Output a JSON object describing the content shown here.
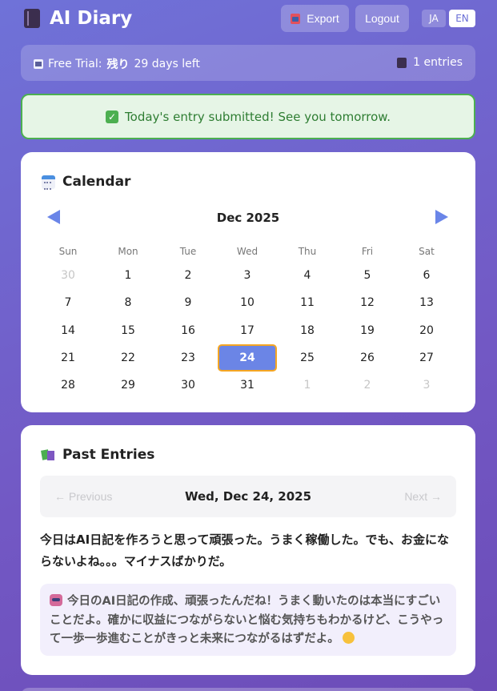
{
  "header": {
    "title": "AI Diary",
    "export_label": "Export",
    "logout_label": "Logout",
    "lang_ja": "JA",
    "lang_en": "EN",
    "selected_language": "EN"
  },
  "trial": {
    "label": "Free Trial:",
    "jp": "残り",
    "days": "29 days left",
    "entries": "1 entries"
  },
  "success_message": "Today's entry submitted! See you tomorrow.",
  "calendar": {
    "title": "Calendar",
    "month": "Dec 2025",
    "weekdays": [
      "Sun",
      "Mon",
      "Tue",
      "Wed",
      "Thu",
      "Fri",
      "Sat"
    ],
    "weeks": [
      [
        "30",
        "1",
        "2",
        "3",
        "4",
        "5",
        "6"
      ],
      [
        "7",
        "8",
        "9",
        "10",
        "11",
        "12",
        "13"
      ],
      [
        "14",
        "15",
        "16",
        "17",
        "18",
        "19",
        "20"
      ],
      [
        "21",
        "22",
        "23",
        "24",
        "25",
        "26",
        "27"
      ],
      [
        "28",
        "29",
        "30",
        "31",
        "1",
        "2",
        "3"
      ]
    ],
    "selected_day": "24"
  },
  "past_entries": {
    "title": "Past Entries",
    "prev_label": "← Previous",
    "next_label": "Next →",
    "date": "Wed, Dec 24, 2025",
    "entry": "今日はAI日記を作ろうと思って頑張った。うまく稼働した。でも、お金にならないよね。。。マイナスばかりだ。",
    "ai_comment": "今日のAI日記の作成、頑張ったんだね！うまく動いたのは本当にすごいことだよ。確かに収益につながらないと悩む気持ちもわかるけど、こうやって一歩一歩進むことがきっと未来につながるはずだよ。"
  },
  "colors": {
    "accent": "#6b85e6",
    "today_border": "#f5a623",
    "success_border": "#4caf50",
    "success_text": "#2e7d32"
  },
  "icons": {
    "brand": "notebook-icon",
    "export": "package-icon",
    "trial": "calendar-small-icon",
    "entries": "book-icon",
    "success": "check-icon",
    "calendar": "calendar-icon",
    "past_entries": "books-icon",
    "ai": "robot-icon",
    "smile": "smile-icon"
  }
}
